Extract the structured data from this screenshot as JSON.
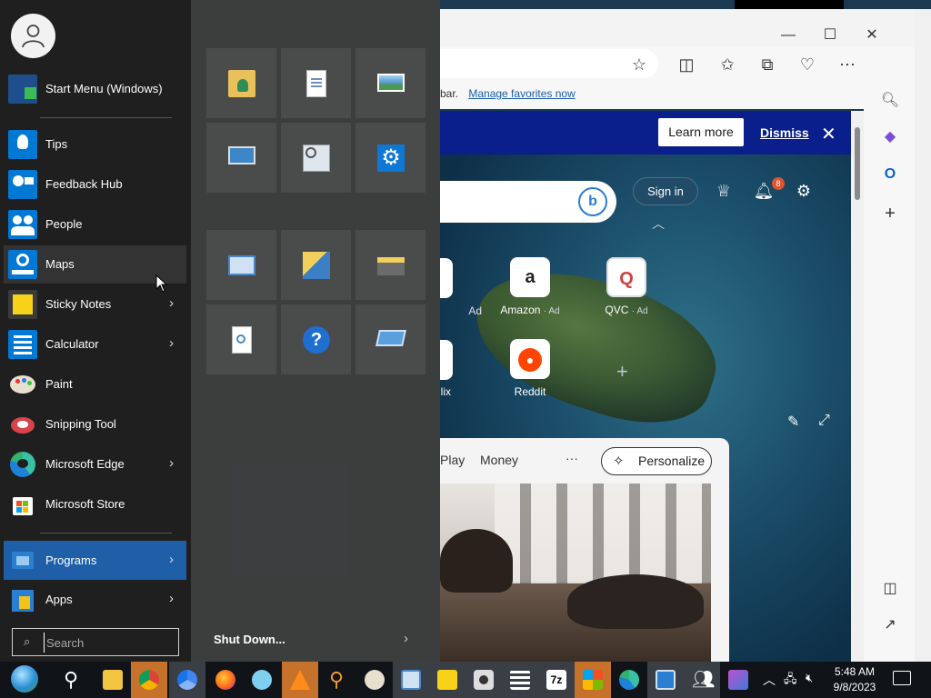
{
  "browser": {
    "window_controls": {
      "minimize": "—",
      "maximize": "☐",
      "close": "✕"
    },
    "favorites_bar": {
      "text": "bar.",
      "link": "Manage favorites now"
    },
    "banner": {
      "learn_more": "Learn more",
      "dismiss": "Dismiss"
    },
    "header": {
      "sign_in": "Sign in",
      "notifications_count": "8"
    },
    "quick_links": [
      {
        "label": "Amazon",
        "ad": "· Ad",
        "glyph": "a"
      },
      {
        "label": "QVC",
        "ad": "· Ad",
        "glyph": "Q"
      },
      {
        "label": "Reddit",
        "ad": "",
        "glyph": "●"
      }
    ],
    "partial_tiles": [
      "Ad",
      "lix"
    ],
    "feed": {
      "tabs": [
        "Play",
        "Money",
        "···"
      ],
      "personalize": "Personalize"
    }
  },
  "start_menu": {
    "items": [
      {
        "label": "Start Menu (Windows)",
        "icon": "start-menu-app-icon",
        "arrow": false
      },
      {
        "label": "Tips",
        "icon": "tips-icon",
        "arrow": false
      },
      {
        "label": "Feedback Hub",
        "icon": "feedback-hub-icon",
        "arrow": false
      },
      {
        "label": "People",
        "icon": "people-icon",
        "arrow": false
      },
      {
        "label": "Maps",
        "icon": "maps-icon",
        "arrow": false
      },
      {
        "label": "Sticky Notes",
        "icon": "sticky-notes-icon",
        "arrow": true
      },
      {
        "label": "Calculator",
        "icon": "calculator-icon",
        "arrow": true
      },
      {
        "label": "Paint",
        "icon": "paint-icon",
        "arrow": false
      },
      {
        "label": "Snipping Tool",
        "icon": "snipping-tool-icon",
        "arrow": false
      },
      {
        "label": "Microsoft Edge",
        "icon": "edge-icon",
        "arrow": true
      },
      {
        "label": "Microsoft Store",
        "icon": "store-icon",
        "arrow": false
      }
    ],
    "programs": {
      "label": "Programs"
    },
    "apps": {
      "label": "Apps"
    },
    "search_placeholder": "Search",
    "shutdown_label": "Shut Down...",
    "pinned_tiles": [
      "user-folder-icon",
      "document-icon",
      "pictures-icon",
      "computer-icon",
      "control-panel-icon",
      "settings-gear-icon",
      "system-info-icon",
      "network-icon",
      "printer-icon",
      "search-document-icon",
      "help-icon",
      "run-icon"
    ]
  },
  "taskbar": {
    "apps": [
      "start-orb-icon",
      "search-icon",
      "file-explorer-icon",
      "chrome-icon",
      "chrome-icon",
      "firefox-icon",
      "weather-icon",
      "vlc-icon",
      "search-tool-icon",
      "paint-icon",
      "control-panel-icon",
      "sticky-notes-icon",
      "camera-icon",
      "calculator-icon",
      "7zip-icon",
      "store-icon",
      "edge-icon",
      "remote-desktop-icon",
      "people-icon",
      "media-icon"
    ],
    "clock": {
      "time": "5:48 AM",
      "date": "9/8/2023"
    },
    "seven_zip_label": "7z"
  },
  "colors": {
    "accent": "#1f5fa8",
    "banner": "#0a1f8c",
    "taskbar": "#101418"
  }
}
